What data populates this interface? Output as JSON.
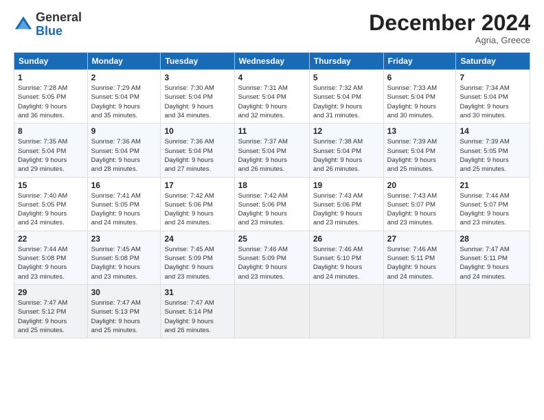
{
  "header": {
    "logo_general": "General",
    "logo_blue": "Blue",
    "month_title": "December 2024",
    "location": "Agria, Greece"
  },
  "weekdays": [
    "Sunday",
    "Monday",
    "Tuesday",
    "Wednesday",
    "Thursday",
    "Friday",
    "Saturday"
  ],
  "weeks": [
    [
      {
        "day": "1",
        "sunrise": "7:28 AM",
        "sunset": "5:05 PM",
        "daylight": "9 hours and 36 minutes."
      },
      {
        "day": "2",
        "sunrise": "7:29 AM",
        "sunset": "5:04 PM",
        "daylight": "9 hours and 35 minutes."
      },
      {
        "day": "3",
        "sunrise": "7:30 AM",
        "sunset": "5:04 PM",
        "daylight": "9 hours and 34 minutes."
      },
      {
        "day": "4",
        "sunrise": "7:31 AM",
        "sunset": "5:04 PM",
        "daylight": "9 hours and 32 minutes."
      },
      {
        "day": "5",
        "sunrise": "7:32 AM",
        "sunset": "5:04 PM",
        "daylight": "9 hours and 31 minutes."
      },
      {
        "day": "6",
        "sunrise": "7:33 AM",
        "sunset": "5:04 PM",
        "daylight": "9 hours and 30 minutes."
      },
      {
        "day": "7",
        "sunrise": "7:34 AM",
        "sunset": "5:04 PM",
        "daylight": "9 hours and 30 minutes."
      }
    ],
    [
      {
        "day": "8",
        "sunrise": "7:35 AM",
        "sunset": "5:04 PM",
        "daylight": "9 hours and 29 minutes."
      },
      {
        "day": "9",
        "sunrise": "7:36 AM",
        "sunset": "5:04 PM",
        "daylight": "9 hours and 28 minutes."
      },
      {
        "day": "10",
        "sunrise": "7:36 AM",
        "sunset": "5:04 PM",
        "daylight": "9 hours and 27 minutes."
      },
      {
        "day": "11",
        "sunrise": "7:37 AM",
        "sunset": "5:04 PM",
        "daylight": "9 hours and 26 minutes."
      },
      {
        "day": "12",
        "sunrise": "7:38 AM",
        "sunset": "5:04 PM",
        "daylight": "9 hours and 26 minutes."
      },
      {
        "day": "13",
        "sunrise": "7:39 AM",
        "sunset": "5:04 PM",
        "daylight": "9 hours and 25 minutes."
      },
      {
        "day": "14",
        "sunrise": "7:39 AM",
        "sunset": "5:05 PM",
        "daylight": "9 hours and 25 minutes."
      }
    ],
    [
      {
        "day": "15",
        "sunrise": "7:40 AM",
        "sunset": "5:05 PM",
        "daylight": "9 hours and 24 minutes."
      },
      {
        "day": "16",
        "sunrise": "7:41 AM",
        "sunset": "5:05 PM",
        "daylight": "9 hours and 24 minutes."
      },
      {
        "day": "17",
        "sunrise": "7:42 AM",
        "sunset": "5:06 PM",
        "daylight": "9 hours and 24 minutes."
      },
      {
        "day": "18",
        "sunrise": "7:42 AM",
        "sunset": "5:06 PM",
        "daylight": "9 hours and 23 minutes."
      },
      {
        "day": "19",
        "sunrise": "7:43 AM",
        "sunset": "5:06 PM",
        "daylight": "9 hours and 23 minutes."
      },
      {
        "day": "20",
        "sunrise": "7:43 AM",
        "sunset": "5:07 PM",
        "daylight": "9 hours and 23 minutes."
      },
      {
        "day": "21",
        "sunrise": "7:44 AM",
        "sunset": "5:07 PM",
        "daylight": "9 hours and 23 minutes."
      }
    ],
    [
      {
        "day": "22",
        "sunrise": "7:44 AM",
        "sunset": "5:08 PM",
        "daylight": "9 hours and 23 minutes."
      },
      {
        "day": "23",
        "sunrise": "7:45 AM",
        "sunset": "5:08 PM",
        "daylight": "9 hours and 23 minutes."
      },
      {
        "day": "24",
        "sunrise": "7:45 AM",
        "sunset": "5:09 PM",
        "daylight": "9 hours and 23 minutes."
      },
      {
        "day": "25",
        "sunrise": "7:46 AM",
        "sunset": "5:09 PM",
        "daylight": "9 hours and 23 minutes."
      },
      {
        "day": "26",
        "sunrise": "7:46 AM",
        "sunset": "5:10 PM",
        "daylight": "9 hours and 24 minutes."
      },
      {
        "day": "27",
        "sunrise": "7:46 AM",
        "sunset": "5:11 PM",
        "daylight": "9 hours and 24 minutes."
      },
      {
        "day": "28",
        "sunrise": "7:47 AM",
        "sunset": "5:11 PM",
        "daylight": "9 hours and 24 minutes."
      }
    ],
    [
      {
        "day": "29",
        "sunrise": "7:47 AM",
        "sunset": "5:12 PM",
        "daylight": "9 hours and 25 minutes."
      },
      {
        "day": "30",
        "sunrise": "7:47 AM",
        "sunset": "5:13 PM",
        "daylight": "9 hours and 25 minutes."
      },
      {
        "day": "31",
        "sunrise": "7:47 AM",
        "sunset": "5:14 PM",
        "daylight": "9 hours and 26 minutes."
      },
      null,
      null,
      null,
      null
    ]
  ]
}
